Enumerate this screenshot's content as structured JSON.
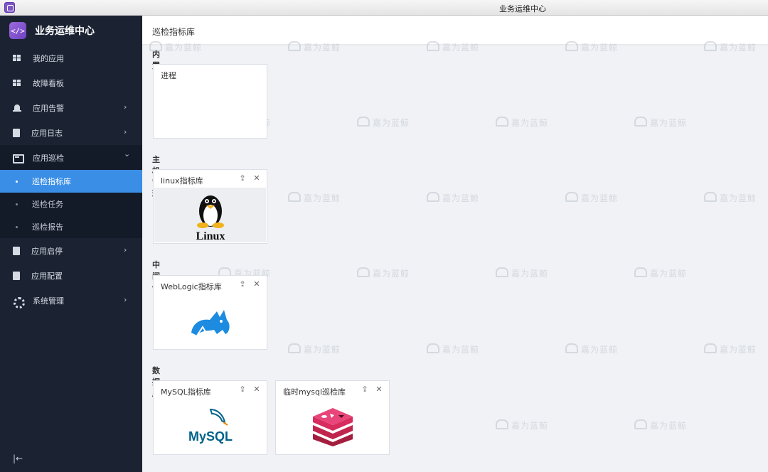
{
  "window": {
    "title": "业务运维中心"
  },
  "brand": {
    "logo_text": "</>",
    "name": "业务运维中心"
  },
  "sidebar": {
    "items": [
      {
        "label": "我的应用",
        "icon": "grid-icon",
        "expandable": false
      },
      {
        "label": "故障看板",
        "icon": "dashboard-icon",
        "expandable": false
      },
      {
        "label": "应用告警",
        "icon": "bell-icon",
        "expandable": true,
        "chevron": "›"
      },
      {
        "label": "应用日志",
        "icon": "document-icon",
        "expandable": true,
        "chevron": "›"
      },
      {
        "label": "应用巡检",
        "icon": "inspection-icon",
        "expandable": true,
        "chevron": "⌄"
      },
      {
        "label": "应用启停",
        "icon": "start-stop-icon",
        "expandable": true,
        "chevron": "›"
      },
      {
        "label": "应用配置",
        "icon": "config-icon",
        "expandable": false
      },
      {
        "label": "系统管理",
        "icon": "gear-icon",
        "expandable": true,
        "chevron": "›"
      }
    ],
    "submenu": [
      {
        "label": "巡检指标库",
        "active": true
      },
      {
        "label": "巡检任务",
        "active": false
      },
      {
        "label": "巡检报告",
        "active": false
      }
    ],
    "collapse_glyph": "|←"
  },
  "header": {
    "page_title": "巡检指标库"
  },
  "sections": [
    {
      "title": "内置",
      "cards": [
        {
          "title": "进程",
          "image": "none"
        }
      ]
    },
    {
      "title": "主机管理",
      "cards": [
        {
          "title": "linux指标库",
          "image": "linux-tux-logo",
          "logo_text": "Linux"
        }
      ]
    },
    {
      "title": "中间件",
      "cards": [
        {
          "title": "WebLogic指标库",
          "image": "tomcat-cat-logo"
        }
      ]
    },
    {
      "title": "数据库",
      "cards": [
        {
          "title": "MySQL指标库",
          "image": "mysql-dolphin-logo",
          "logo_text": "MySQL"
        },
        {
          "title": "临时mysql巡检库",
          "image": "redis-cube-logo"
        }
      ]
    }
  ],
  "card_actions": {
    "upload_glyph": "⇪",
    "close_glyph": "✕"
  },
  "watermark": {
    "text": "嘉为蓝鲸"
  },
  "colors": {
    "sidebar_bg": "#1b2333",
    "active_blue": "#3a8ee6",
    "mysql_blue": "#00618a",
    "mysql_orange": "#e48e00",
    "redis_red": "#d82c5f",
    "tomcat_blue": "#1c8be0"
  }
}
